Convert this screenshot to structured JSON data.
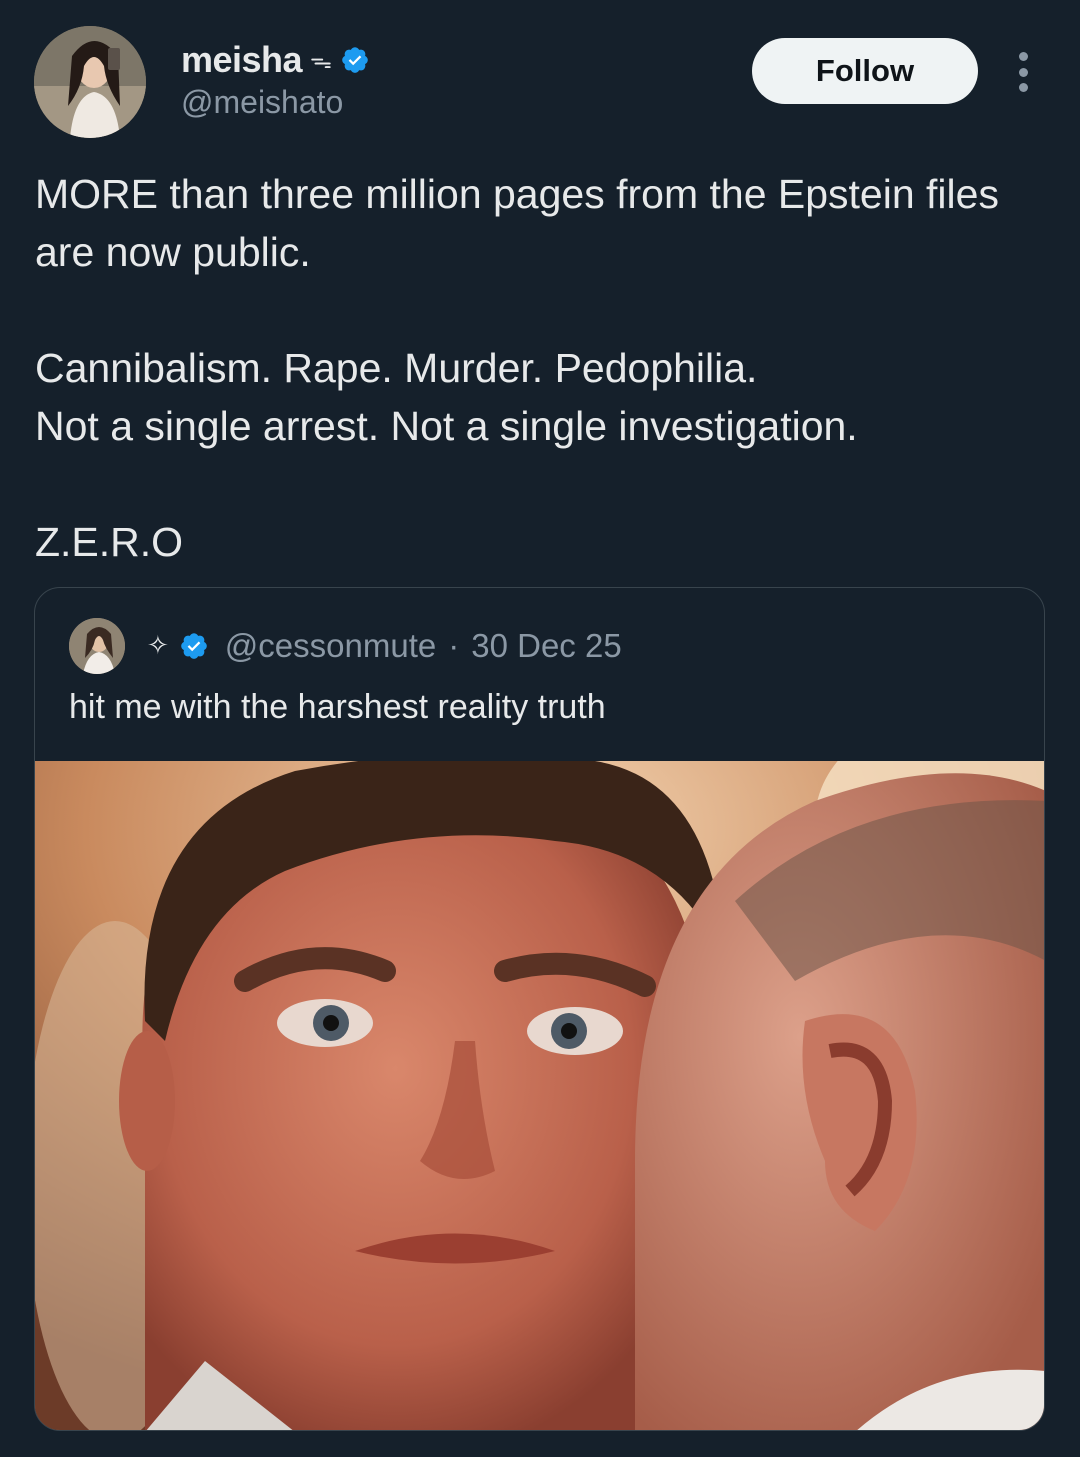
{
  "author": {
    "display_name": "meisha",
    "emoji": "ᯓ",
    "handle": "@meishato",
    "verified_icon": "verified-badge-icon"
  },
  "follow_label": "Follow",
  "tweet": {
    "line1": "MORE than three million pages from the Epstein files are now public.",
    "line2": "Cannibalism. Rape. Murder. Pedophilia.",
    "line3": "Not a single arrest. Not a single investigation.",
    "line4": "Z.E.R.O"
  },
  "quoted": {
    "sparkle": "✧",
    "handle": "@cessonmute",
    "separator": "·",
    "date": "30 Dec 25",
    "text": "hit me with the harshest reality truth",
    "media_icon": "photo-image"
  },
  "colors": {
    "background": "#15202b",
    "text": "#e7e9ea",
    "secondary": "#8b98a5",
    "verified": "#1d9bf0",
    "border": "#38444d"
  }
}
